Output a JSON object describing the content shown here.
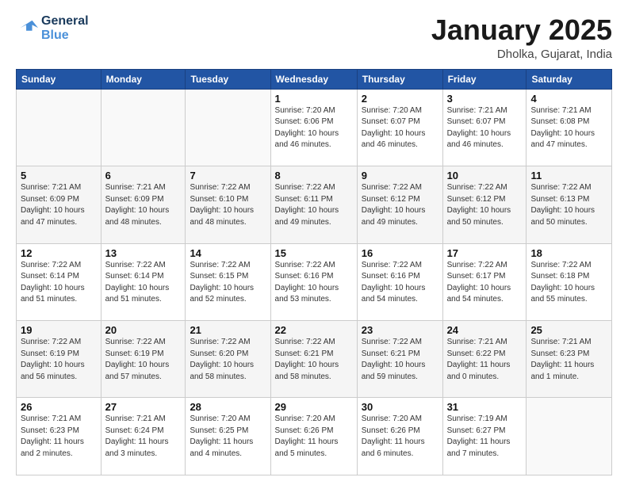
{
  "logo": {
    "line1": "General",
    "line2": "Blue"
  },
  "title": "January 2025",
  "subtitle": "Dholka, Gujarat, India",
  "days_of_week": [
    "Sunday",
    "Monday",
    "Tuesday",
    "Wednesday",
    "Thursday",
    "Friday",
    "Saturday"
  ],
  "weeks": [
    [
      {
        "day": "",
        "info": ""
      },
      {
        "day": "",
        "info": ""
      },
      {
        "day": "",
        "info": ""
      },
      {
        "day": "1",
        "info": "Sunrise: 7:20 AM\nSunset: 6:06 PM\nDaylight: 10 hours\nand 46 minutes."
      },
      {
        "day": "2",
        "info": "Sunrise: 7:20 AM\nSunset: 6:07 PM\nDaylight: 10 hours\nand 46 minutes."
      },
      {
        "day": "3",
        "info": "Sunrise: 7:21 AM\nSunset: 6:07 PM\nDaylight: 10 hours\nand 46 minutes."
      },
      {
        "day": "4",
        "info": "Sunrise: 7:21 AM\nSunset: 6:08 PM\nDaylight: 10 hours\nand 47 minutes."
      }
    ],
    [
      {
        "day": "5",
        "info": "Sunrise: 7:21 AM\nSunset: 6:09 PM\nDaylight: 10 hours\nand 47 minutes."
      },
      {
        "day": "6",
        "info": "Sunrise: 7:21 AM\nSunset: 6:09 PM\nDaylight: 10 hours\nand 48 minutes."
      },
      {
        "day": "7",
        "info": "Sunrise: 7:22 AM\nSunset: 6:10 PM\nDaylight: 10 hours\nand 48 minutes."
      },
      {
        "day": "8",
        "info": "Sunrise: 7:22 AM\nSunset: 6:11 PM\nDaylight: 10 hours\nand 49 minutes."
      },
      {
        "day": "9",
        "info": "Sunrise: 7:22 AM\nSunset: 6:12 PM\nDaylight: 10 hours\nand 49 minutes."
      },
      {
        "day": "10",
        "info": "Sunrise: 7:22 AM\nSunset: 6:12 PM\nDaylight: 10 hours\nand 50 minutes."
      },
      {
        "day": "11",
        "info": "Sunrise: 7:22 AM\nSunset: 6:13 PM\nDaylight: 10 hours\nand 50 minutes."
      }
    ],
    [
      {
        "day": "12",
        "info": "Sunrise: 7:22 AM\nSunset: 6:14 PM\nDaylight: 10 hours\nand 51 minutes."
      },
      {
        "day": "13",
        "info": "Sunrise: 7:22 AM\nSunset: 6:14 PM\nDaylight: 10 hours\nand 51 minutes."
      },
      {
        "day": "14",
        "info": "Sunrise: 7:22 AM\nSunset: 6:15 PM\nDaylight: 10 hours\nand 52 minutes."
      },
      {
        "day": "15",
        "info": "Sunrise: 7:22 AM\nSunset: 6:16 PM\nDaylight: 10 hours\nand 53 minutes."
      },
      {
        "day": "16",
        "info": "Sunrise: 7:22 AM\nSunset: 6:16 PM\nDaylight: 10 hours\nand 54 minutes."
      },
      {
        "day": "17",
        "info": "Sunrise: 7:22 AM\nSunset: 6:17 PM\nDaylight: 10 hours\nand 54 minutes."
      },
      {
        "day": "18",
        "info": "Sunrise: 7:22 AM\nSunset: 6:18 PM\nDaylight: 10 hours\nand 55 minutes."
      }
    ],
    [
      {
        "day": "19",
        "info": "Sunrise: 7:22 AM\nSunset: 6:19 PM\nDaylight: 10 hours\nand 56 minutes."
      },
      {
        "day": "20",
        "info": "Sunrise: 7:22 AM\nSunset: 6:19 PM\nDaylight: 10 hours\nand 57 minutes."
      },
      {
        "day": "21",
        "info": "Sunrise: 7:22 AM\nSunset: 6:20 PM\nDaylight: 10 hours\nand 58 minutes."
      },
      {
        "day": "22",
        "info": "Sunrise: 7:22 AM\nSunset: 6:21 PM\nDaylight: 10 hours\nand 58 minutes."
      },
      {
        "day": "23",
        "info": "Sunrise: 7:22 AM\nSunset: 6:21 PM\nDaylight: 10 hours\nand 59 minutes."
      },
      {
        "day": "24",
        "info": "Sunrise: 7:21 AM\nSunset: 6:22 PM\nDaylight: 11 hours\nand 0 minutes."
      },
      {
        "day": "25",
        "info": "Sunrise: 7:21 AM\nSunset: 6:23 PM\nDaylight: 11 hours\nand 1 minute."
      }
    ],
    [
      {
        "day": "26",
        "info": "Sunrise: 7:21 AM\nSunset: 6:23 PM\nDaylight: 11 hours\nand 2 minutes."
      },
      {
        "day": "27",
        "info": "Sunrise: 7:21 AM\nSunset: 6:24 PM\nDaylight: 11 hours\nand 3 minutes."
      },
      {
        "day": "28",
        "info": "Sunrise: 7:20 AM\nSunset: 6:25 PM\nDaylight: 11 hours\nand 4 minutes."
      },
      {
        "day": "29",
        "info": "Sunrise: 7:20 AM\nSunset: 6:26 PM\nDaylight: 11 hours\nand 5 minutes."
      },
      {
        "day": "30",
        "info": "Sunrise: 7:20 AM\nSunset: 6:26 PM\nDaylight: 11 hours\nand 6 minutes."
      },
      {
        "day": "31",
        "info": "Sunrise: 7:19 AM\nSunset: 6:27 PM\nDaylight: 11 hours\nand 7 minutes."
      },
      {
        "day": "",
        "info": ""
      }
    ]
  ]
}
